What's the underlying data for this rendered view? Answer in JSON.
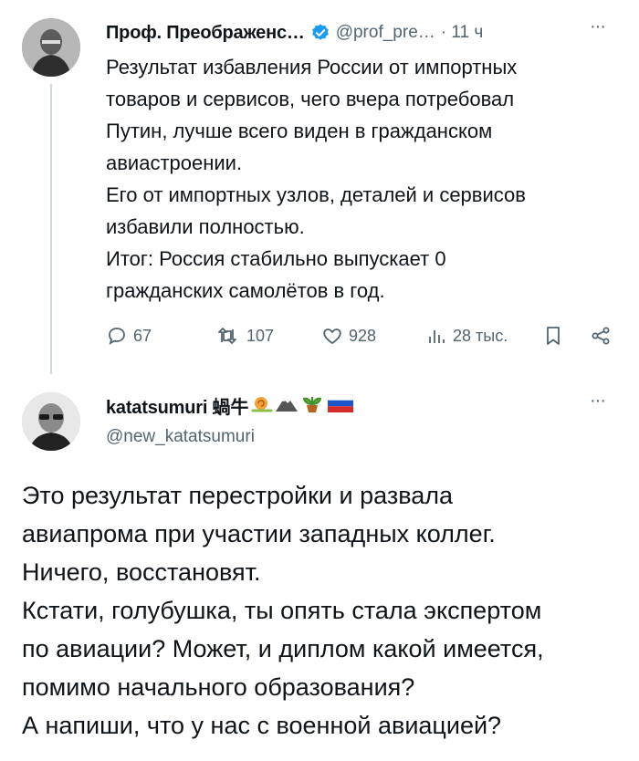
{
  "tweet1": {
    "name": "Проф. Преображенс…",
    "handle": "@prof_pre…",
    "time": "· 11 ч",
    "more": "···",
    "lines": [
      "Результат избавления России от импортных",
      "товаров и сервисов, чего вчера потребовал",
      "Путин, лучше всего виден в гражданском",
      "авиастроении.",
      "Его от импортных узлов, деталей и сервисов",
      "избавили полностью.",
      "Итог: Россия стабильно выпускает 0",
      "гражданских самолётов в год."
    ],
    "actions": {
      "replies": "67",
      "retweets": "107",
      "likes": "928",
      "views": "28 тыс."
    }
  },
  "tweet2": {
    "name": "katatsumuri 蝸牛",
    "handle": "@new_katatsumuri",
    "more": "···",
    "lines": [
      "Это результат перестройки и развала",
      "авиапрома при участии западных коллег.",
      "Ничего, восстановят.",
      "Кстати, голубушка, ты опять стала экспертом",
      "по авиации? Может, и диплом какой имеется,",
      "помимо начального образования?",
      "А напиши, что у нас с военной авиацией?"
    ]
  },
  "colors": {
    "verified": "#1d9bf0",
    "muted": "#536471",
    "line": "#cfd9de"
  },
  "icons": [
    "reply-icon",
    "retweet-icon",
    "like-icon",
    "views-icon",
    "bookmark-icon",
    "share-icon",
    "verified-badge-icon"
  ]
}
